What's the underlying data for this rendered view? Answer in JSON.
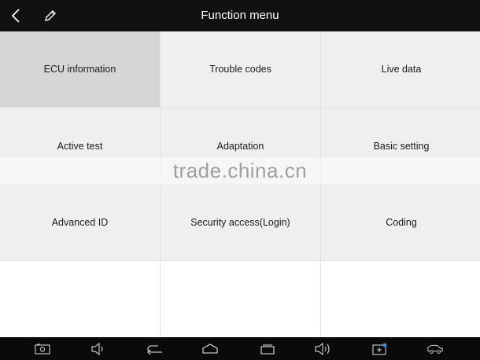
{
  "header": {
    "title": "Function menu",
    "back_icon": "chevron-left-icon",
    "edit_icon": "pencil-icon"
  },
  "menu": {
    "items": [
      {
        "label": "ECU information",
        "selected": true
      },
      {
        "label": "Trouble codes"
      },
      {
        "label": "Live data"
      },
      {
        "label": "Active test"
      },
      {
        "label": "Adaptation"
      },
      {
        "label": "Basic setting"
      },
      {
        "label": "Advanced ID"
      },
      {
        "label": "Security access(Login)"
      },
      {
        "label": "Coding"
      }
    ]
  },
  "watermark": "trade.china.cn",
  "navbar": {
    "icons": [
      "screenshot-icon",
      "volume-down-icon",
      "back-icon",
      "home-icon",
      "recent-apps-icon",
      "volume-up-icon",
      "add-shortcut-icon",
      "vehicle-icon"
    ]
  },
  "colors": {
    "topbar": "#111111",
    "tile": "#efefef",
    "tile_selected": "#d6d6d6",
    "navbar": "#0a0a0a"
  }
}
